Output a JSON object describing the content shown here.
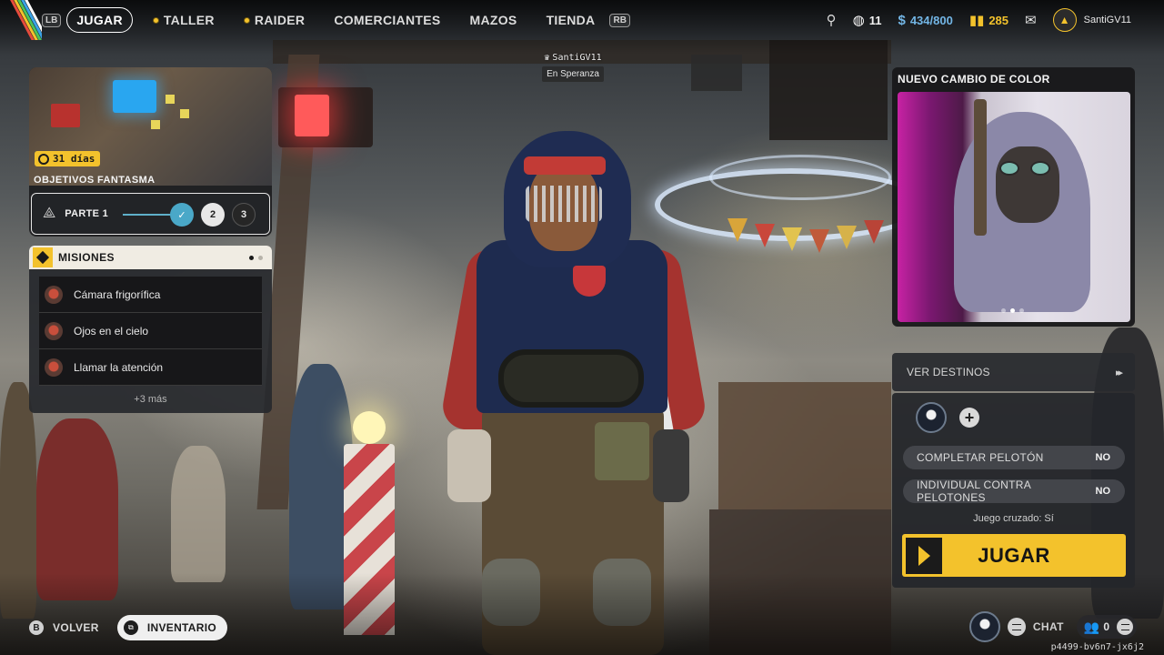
{
  "nav": {
    "left_bumper": "LB",
    "right_bumper": "RB",
    "items": [
      {
        "label": "JUGAR",
        "active": true,
        "dot": false
      },
      {
        "label": "TALLER",
        "active": false,
        "dot": true
      },
      {
        "label": "RAIDER",
        "active": false,
        "dot": true
      },
      {
        "label": "COMERCIANTES",
        "active": false,
        "dot": false
      },
      {
        "label": "MAZOS",
        "active": false,
        "dot": false
      },
      {
        "label": "TIENDA",
        "active": false,
        "dot": false
      }
    ]
  },
  "currencies": {
    "tokens": "11",
    "credits": "434/800",
    "coins": "285"
  },
  "profile": {
    "name": "SantiGV11"
  },
  "overhead": {
    "name": "SantiGV11",
    "location": "En Speranza"
  },
  "ghost": {
    "days": "31 días",
    "title": "OBJETIVOS FANTASMA",
    "part_label": "PARTE 1",
    "step2": "2",
    "step3": "3"
  },
  "missions": {
    "title": "MISIONES",
    "items": [
      {
        "label": "Cámara frigorífica"
      },
      {
        "label": "Ojos en el cielo"
      },
      {
        "label": "Llamar la atención"
      }
    ],
    "more": "+3 más"
  },
  "promo": {
    "title": "NUEVO CAMBIO DE COLOR"
  },
  "destinations": {
    "label": "VER DESTINOS"
  },
  "queue": {
    "options": [
      {
        "label": "COMPLETAR PELOTÓN",
        "value": "NO"
      },
      {
        "label": "INDIVIDUAL CONTRA PELOTONES",
        "value": "NO"
      }
    ],
    "crossplay": "Juego cruzado: Sí",
    "play_label": "JUGAR"
  },
  "bottom": {
    "back_key": "B",
    "back_label": "VOLVER",
    "inventory_label": "INVENTARIO",
    "chat_label": "CHAT",
    "friends_count": "0"
  },
  "session_id": "p4499-bv6n7-jx6j2",
  "colors": {
    "accent": "#f3c22c",
    "panel": "#26282c"
  },
  "icons": {
    "timer": "stopwatch-icon",
    "chevron": "play-chevron-icon"
  }
}
